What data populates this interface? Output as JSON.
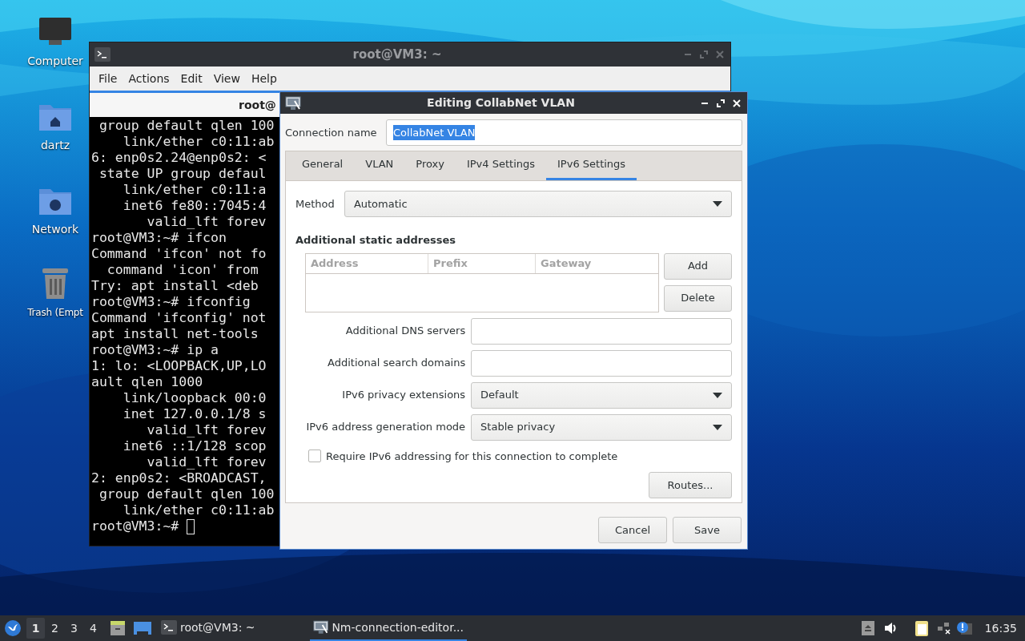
{
  "desktop_icons": [
    {
      "kind": "computer",
      "label": "Computer"
    },
    {
      "kind": "home",
      "label": "dartz"
    },
    {
      "kind": "network",
      "label": "Network"
    },
    {
      "kind": "trash",
      "label": "Trash (Empt"
    }
  ],
  "terminal": {
    "title": "root@VM3: ~",
    "menu": [
      "File",
      "Actions",
      "Edit",
      "View",
      "Help"
    ],
    "tab_label": "root@",
    "lines": [
      " group default qlen 100",
      "    link/ether c0:11:ab",
      "6: enp0s2.24@enp0s2: <",
      " state UP group defaul",
      "    link/ether c0:11:a",
      "    inet6 fe80::7045:4",
      "       valid_lft forev",
      "root@VM3:~# ifcon",
      "Command 'ifcon' not fo",
      "  command 'icon' from",
      "Try: apt install <deb",
      "root@VM3:~# ifconfig",
      "Command 'ifconfig' not",
      "apt install net-tools",
      "root@VM3:~# ip a",
      "1: lo: <LOOPBACK,UP,LO",
      "ault qlen 1000",
      "    link/loopback 00:0",
      "    inet 127.0.0.1/8 s",
      "       valid_lft forev",
      "    inet6 ::1/128 scop",
      "       valid_lft forev",
      "2: enp0s2: <BROADCAST,",
      " group default qlen 100",
      "    link/ether c0:11:ab",
      "root@VM3:~# "
    ]
  },
  "dialog": {
    "title": "Editing CollabNet VLAN",
    "connection_name": {
      "label": "Connection name",
      "value": "CollabNet VLAN",
      "text_selected": true
    },
    "tabs": [
      {
        "label": "General",
        "selected": false
      },
      {
        "label": "VLAN",
        "selected": false
      },
      {
        "label": "Proxy",
        "selected": false
      },
      {
        "label": "IPv4 Settings",
        "selected": false
      },
      {
        "label": "IPv6 Settings",
        "selected": true
      }
    ],
    "method": {
      "label": "Method",
      "value": "Automatic"
    },
    "static_addresses": {
      "heading": "Additional static addresses",
      "columns": [
        "Address",
        "Prefix",
        "Gateway"
      ],
      "buttons": [
        "Add",
        "Delete"
      ]
    },
    "fields": [
      {
        "kind": "text",
        "label": "Additional DNS servers"
      },
      {
        "kind": "text",
        "label": "Additional search domains"
      },
      {
        "kind": "dropdown",
        "label": "IPv6 privacy extensions",
        "value": "Default"
      },
      {
        "kind": "dropdown",
        "label": "IPv6 address generation mode",
        "value": "Stable privacy"
      }
    ],
    "require_checkbox": {
      "label": "Require IPv6 addressing for this connection to complete",
      "checked": false
    },
    "routes_button": "Routes...",
    "buttons": [
      "Cancel",
      "Save"
    ]
  },
  "taskbar": {
    "workspaces": [
      {
        "label": "1",
        "selected": true
      },
      {
        "label": "2",
        "selected": false
      },
      {
        "label": "3",
        "selected": false
      },
      {
        "label": "4",
        "selected": false
      }
    ],
    "tasks": [
      {
        "kind": "terminal",
        "label": "root@VM3: ~",
        "selected": false
      },
      {
        "kind": "network",
        "label": "Nm-connection-editor...",
        "selected": true
      }
    ],
    "clock": "16:35"
  }
}
